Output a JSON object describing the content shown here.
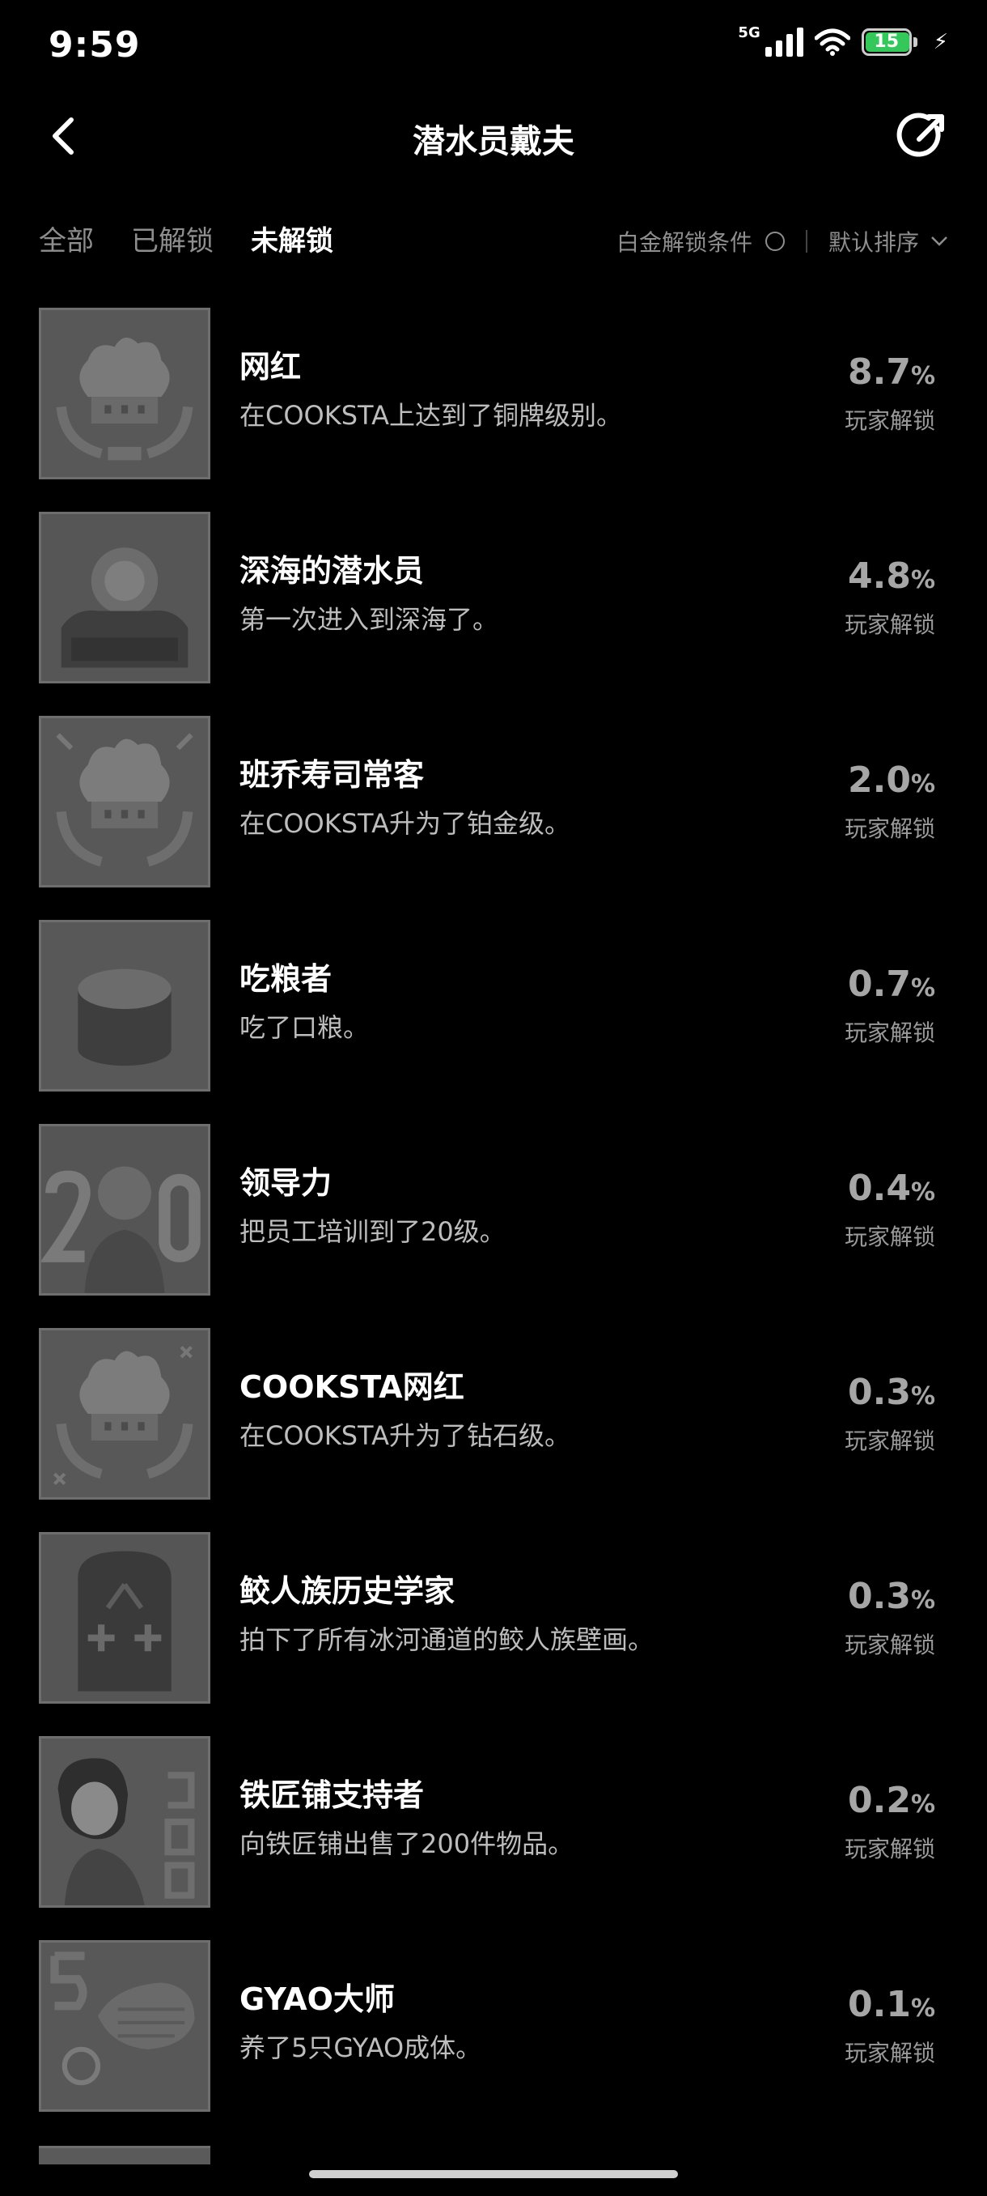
{
  "status": {
    "time": "9:59",
    "network": "5G",
    "battery": "15"
  },
  "header": {
    "title": "潜水员戴夫"
  },
  "tabs": [
    {
      "label": "全部",
      "active": false
    },
    {
      "label": "已解锁",
      "active": false
    },
    {
      "label": "未解锁",
      "active": true
    }
  ],
  "filters": {
    "platinum": "白金解锁条件",
    "sort": "默认排序"
  },
  "achievements": [
    {
      "name": "网红",
      "desc": "在COOKSTA上达到了铜牌级别。",
      "pct": "8.7",
      "label": "玩家解锁",
      "icon": "chef-hat-wreath-icon"
    },
    {
      "name": "深海的潜水员",
      "desc": "第一次进入到深海了。",
      "pct": "4.8",
      "label": "玩家解锁",
      "icon": "deep-sea-diver-icon"
    },
    {
      "name": "班乔寿司常客",
      "desc": "在COOKSTA升为了铂金级。",
      "pct": "2.0",
      "label": "玩家解锁",
      "icon": "chef-hat-wreath-icon"
    },
    {
      "name": "吃粮者",
      "desc": "吃了口粮。",
      "pct": "0.7",
      "label": "玩家解锁",
      "icon": "ration-can-icon"
    },
    {
      "name": "领导力",
      "desc": "把员工培训到了20级。",
      "pct": "0.4",
      "label": "玩家解锁",
      "icon": "staff-level-20-icon"
    },
    {
      "name": "COOKSTA网红",
      "desc": "在COOKSTA升为了钻石级。",
      "pct": "0.3",
      "label": "玩家解锁",
      "icon": "chef-hat-wreath-icon"
    },
    {
      "name": "鲛人族历史学家",
      "desc": "拍下了所有冰河通道的鲛人族壁画。",
      "pct": "0.3",
      "label": "玩家解锁",
      "icon": "mural-icon"
    },
    {
      "name": "铁匠铺支持者",
      "desc": "向铁匠铺出售了200件物品。",
      "pct": "0.2",
      "label": "玩家解锁",
      "icon": "blacksmith-200-icon"
    },
    {
      "name": "GYAO大师",
      "desc": "养了5只GYAO成体。",
      "pct": "0.1",
      "label": "玩家解锁",
      "icon": "gyao-5-icon"
    }
  ]
}
